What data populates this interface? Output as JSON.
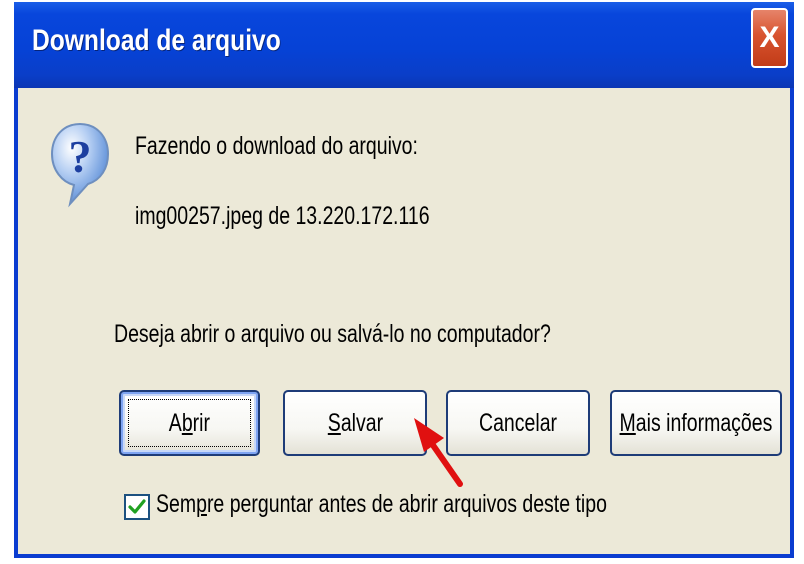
{
  "window": {
    "title": "Download de arquivo",
    "close_symbol": "X"
  },
  "message": {
    "line1": "Fazendo o download do arquivo:",
    "file_info": "img00257.jpeg de 13.220.172.116",
    "question": "Deseja abrir o arquivo ou salvá-lo no computador?"
  },
  "buttons": {
    "open": {
      "pre": "A",
      "ul": "b",
      "post": "rir"
    },
    "save": {
      "pre": "",
      "ul": "S",
      "post": "alvar"
    },
    "cancel": {
      "label": "Cancelar"
    },
    "more_info": {
      "pre": "",
      "ul": "M",
      "post": "ais informações"
    }
  },
  "checkbox": {
    "checked": true,
    "pre": "Sem",
    "ul": "p",
    "post": "re perguntar antes de abrir arquivos deste tipo"
  },
  "icons": {
    "question": "question-icon",
    "pointer": "red-arrow-icon",
    "check": "checkmark-icon"
  },
  "colors": {
    "titlebar": "#0642d6",
    "close": "#d8532f",
    "dialog_bg": "#ece9d8",
    "check": "#21a121",
    "arrow": "#e01010"
  }
}
